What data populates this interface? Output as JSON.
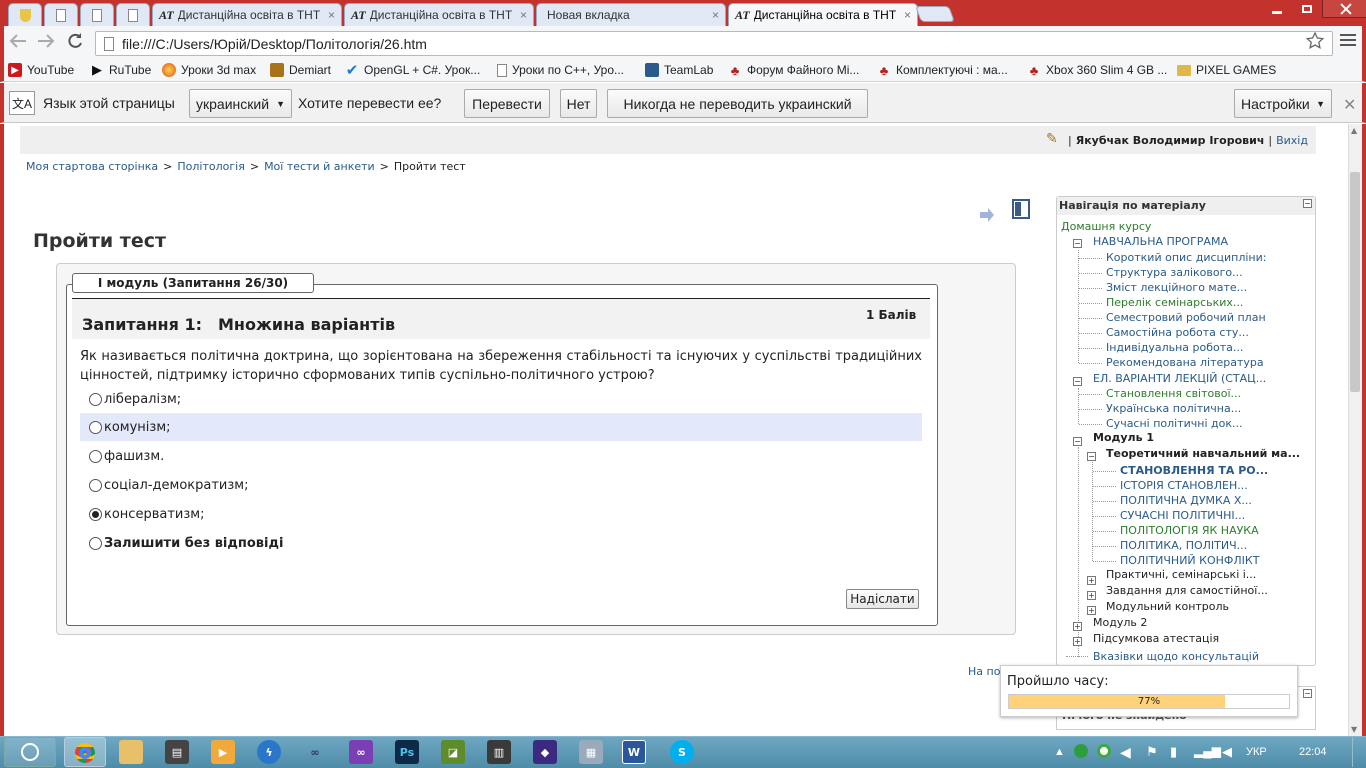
{
  "browser": {
    "tabs": [
      {
        "label": "Дистанційна освіта в ТНТ",
        "badge": "AT"
      },
      {
        "label": "Дистанційна освіта в ТНТ",
        "badge": "AT"
      },
      {
        "label": "Новая вкладка",
        "badge": ""
      },
      {
        "label": "Дистанційна освіта в ТНТ",
        "badge": "AT"
      }
    ],
    "close_glyph": "×",
    "url": "file:///C:/Users/Юрій/Desktop/Політологія/26.htm",
    "bookmarks": [
      {
        "label": "YouTube",
        "color": "#cc181e"
      },
      {
        "label": "RuTube",
        "color": "#111111"
      },
      {
        "label": "Уроки 3d max",
        "color": "#e8a317"
      },
      {
        "label": "Demiart",
        "color": "#a8741a"
      },
      {
        "label": "OpenGL + C#. Урок...",
        "color": "#1f7ad6"
      },
      {
        "label": "Уроки по C++, Уро...",
        "color": "#888888"
      },
      {
        "label": "TeamLab",
        "color": "#2c5a8c"
      },
      {
        "label": "Форум Файного Мі...",
        "color": "#b22222"
      },
      {
        "label": "Комплектуючі : ма...",
        "color": "#b22222"
      },
      {
        "label": "Xbox 360 Slim 4 GB ...",
        "color": "#b22222"
      },
      {
        "label": "PIXEL GAMES",
        "color": "#e0b84a"
      }
    ]
  },
  "translate": {
    "prompt": "Язык этой страницы",
    "language": "украинский",
    "question": "Хотите перевести ее?",
    "translate_btn": "Перевести",
    "no_btn": "Нет",
    "never_btn": "Никогда не переводить украинский",
    "settings_btn": "Настройки"
  },
  "user": {
    "separator": "|",
    "name": "Якубчак Володимир Ігорович",
    "logout": "Вихід"
  },
  "breadcrumb": {
    "items": [
      "Моя стартова сторінка",
      "Політологія",
      "Мої тести й анкети",
      "Пройти тест"
    ],
    "sep": ">"
  },
  "page_title": "Пройти тест",
  "quiz": {
    "legend": "І модуль (Запитання 26/30)",
    "question_no": "Запитання 1:",
    "question_type": "Множина варіантів",
    "points": "1 Балів",
    "text": "Як називається політична доктрина, що зорієнтована на збереження стабільності та існуючих у суспільстві традиційних цінностей, підтримку історично сформованих типів суспільно-політичного устрою?",
    "options": [
      {
        "label": "лібералізм;",
        "checked": false
      },
      {
        "label": "комунізм;",
        "checked": false
      },
      {
        "label": "фашизм.",
        "checked": false
      },
      {
        "label": "соціал-демократизм;",
        "checked": false
      },
      {
        "label": "консерватизм;",
        "checked": true
      },
      {
        "label": "Залишити без відповіді",
        "checked": false
      }
    ],
    "submit": "Надіслати"
  },
  "nav": {
    "title": "Навігація по матеріалу",
    "home": "Домашня курсу",
    "program": "НАВЧАЛЬНА ПРОГРАМА",
    "program_items": [
      "Короткий опис дисципліни:",
      "Структура залікового...",
      "Зміст лекційного мате...",
      "Перелік семінарських...",
      "Семестровий робочий план",
      "Самостійна робота сту...",
      "Індивідуальна робота...",
      "Рекомендована література"
    ],
    "lectures": "ЕЛ. ВАРІАНТИ ЛЕКЦІЙ (СТАЦ...",
    "lecture_items": [
      "Становлення світової...",
      "Українська політична...",
      "Сучасні політичні док..."
    ],
    "module1": "Модуль 1",
    "theory": "Теоретичний навчальний ма...",
    "theory_items": [
      "СТАНОВЛЕННЯ ТА РО...",
      "ІСТОРІЯ СТАНОВЛЕН...",
      "ПОЛІТИЧНА ДУМКА Х...",
      "СУЧАСНІ ПОЛІТИЧНІ...",
      "ПОЛІТОЛОГІЯ ЯК НАУКА",
      "ПОЛІТИКА, ПОЛІТИЧ...",
      "ПОЛІТИЧНИЙ КОНФЛІКТ"
    ],
    "practical": "Практичні, семінарські і...",
    "selfwork": "Завдання для самостійної...",
    "control": "Модульний контроль",
    "module2": "Модуль 2",
    "final": "Підсумкова атестація",
    "consult": "Вказівки щодо консультацій",
    "minus": "−",
    "plus": "+"
  },
  "timer": {
    "label": "Пройшло часу:",
    "percent_text": "77%",
    "percent": 77
  },
  "footer_partial": "На по",
  "below_partial": "Нічого не знайдено",
  "tray": {
    "lang": "УКР",
    "time": "22:04"
  },
  "colors": {
    "frame": "#c4322d",
    "accent_link": "#2a5a8a",
    "green_link": "#2d7c2d",
    "highlight": "#e4e8fb",
    "progress": "#ffd27a"
  }
}
